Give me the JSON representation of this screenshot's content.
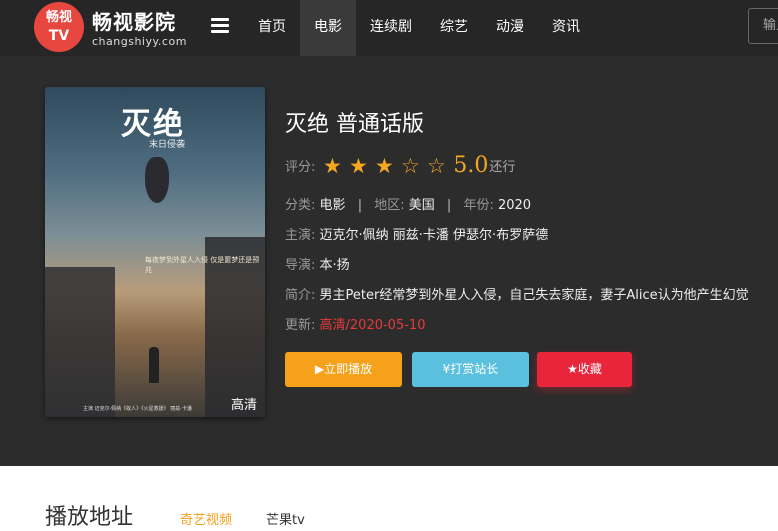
{
  "header": {
    "logo": {
      "line1": "畅视",
      "line2": "TV",
      "title": "畅视影院",
      "domain": "changshiyy.com"
    },
    "nav": [
      "首页",
      "电影",
      "连续剧",
      "综艺",
      "动漫",
      "资讯"
    ],
    "active_nav": "电影",
    "search_placeholder": "输入"
  },
  "poster": {
    "title": "灭绝",
    "subtitle": "末日侵袭",
    "tagline": "每夜梦到外星人入侵 仅是噩梦还是预兆",
    "credits": "主演 迈克尔·佩纳《蚁人》《火星救援》 丽兹·卡潘",
    "badge": "高清"
  },
  "movie": {
    "title": "灭绝 普通话版",
    "rating": {
      "label": "评分:",
      "filled": 3,
      "total": 5,
      "score": "5.0",
      "suffix": "还行"
    },
    "category": {
      "label": "分类:",
      "value": "电影"
    },
    "region": {
      "label": "地区:",
      "value": "美国"
    },
    "year": {
      "label": "年份:",
      "value": "2020"
    },
    "actors": {
      "label": "主演:",
      "value": "迈克尔·佩纳 丽兹·卡潘 伊瑟尔·布罗萨德"
    },
    "director": {
      "label": "导演:",
      "value": "本·扬"
    },
    "intro": {
      "label": "简介:",
      "value": "男主Peter经常梦到外星人入侵，自己失去家庭，妻子Alice认为他产生幻觉"
    },
    "update": {
      "label": "更新:",
      "value": "高清/2020-05-10"
    }
  },
  "buttons": {
    "play": "▶立即播放",
    "tip": "¥打赏站长",
    "fav": "★收藏"
  },
  "play_section": {
    "title": "播放地址",
    "tabs": [
      "奇艺视频",
      "芒果tv"
    ]
  },
  "colors": {
    "accent": "#f5a11a",
    "header_bg": "#262626",
    "detail_bg": "#2c2c2c",
    "fav": "#e8253a",
    "tip": "#5bc0de"
  }
}
